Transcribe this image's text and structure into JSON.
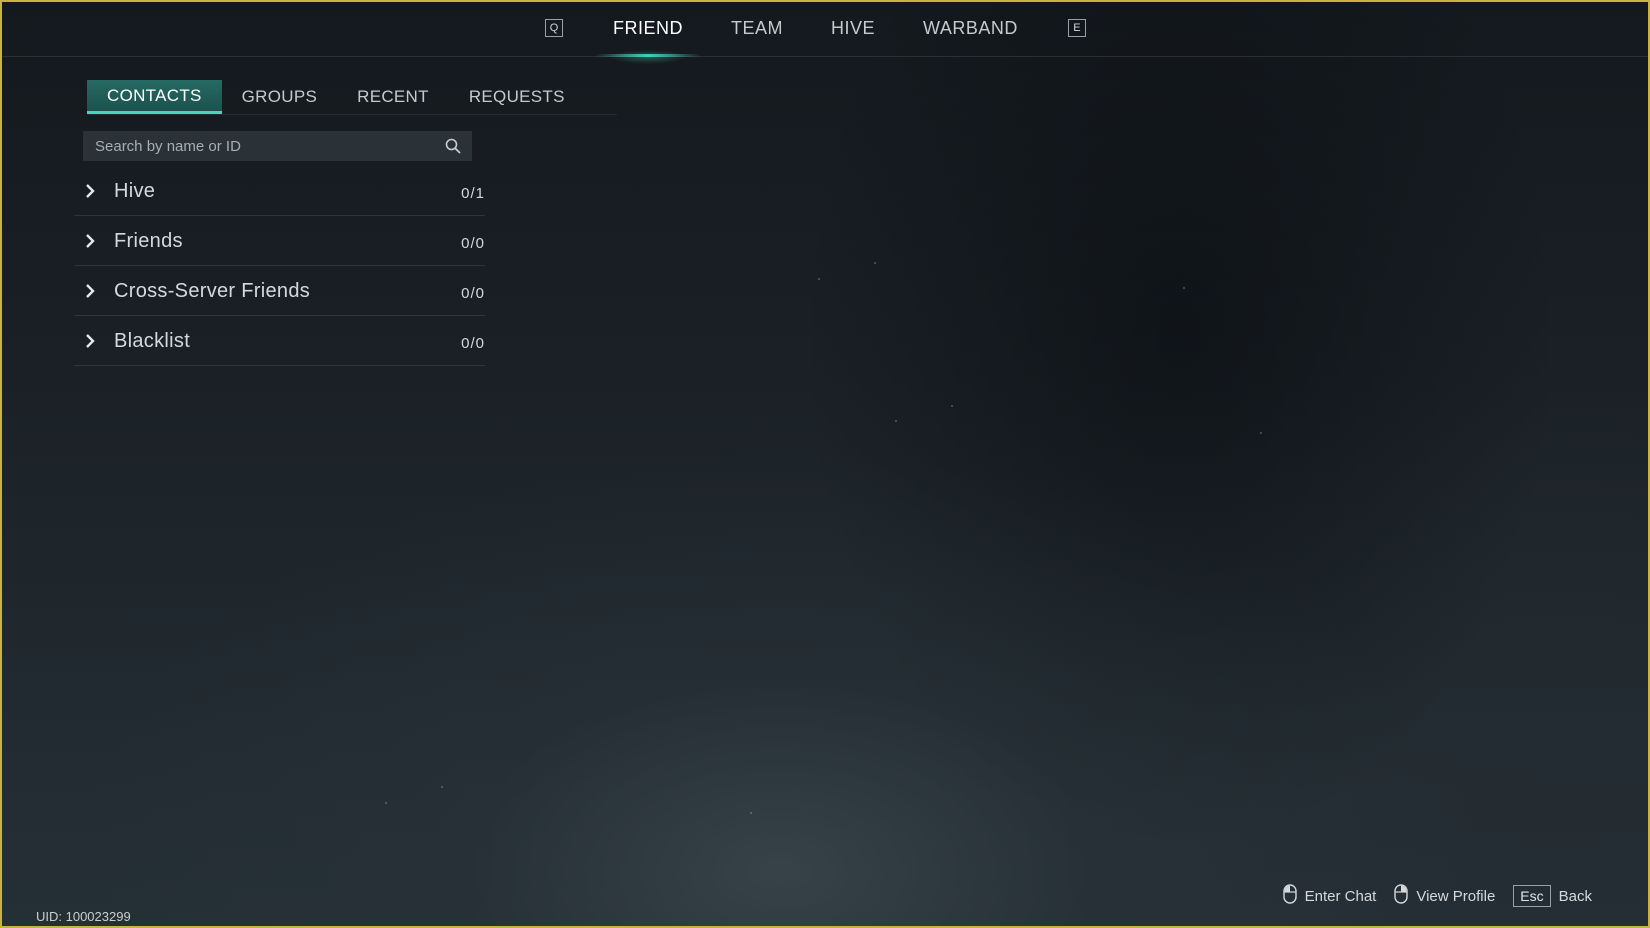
{
  "top_nav": {
    "prev_key": "Q",
    "next_key": "E",
    "tabs": [
      {
        "label": "FRIEND",
        "active": true
      },
      {
        "label": "TEAM",
        "active": false
      },
      {
        "label": "HIVE",
        "active": false
      },
      {
        "label": "WARBAND",
        "active": false
      }
    ]
  },
  "sub_tabs": [
    {
      "label": "CONTACTS",
      "active": true
    },
    {
      "label": "GROUPS",
      "active": false
    },
    {
      "label": "RECENT",
      "active": false
    },
    {
      "label": "REQUESTS",
      "active": false
    }
  ],
  "search": {
    "placeholder": "Search by name or ID",
    "value": "",
    "icon": "search-icon"
  },
  "groups": [
    {
      "name": "Hive",
      "count": "0/1"
    },
    {
      "name": "Friends",
      "count": "0/0"
    },
    {
      "name": "Cross-Server Friends",
      "count": "0/0"
    },
    {
      "name": "Blacklist",
      "count": "0/0"
    }
  ],
  "footer": {
    "uid": "UID: 100023299",
    "hints": {
      "enter_chat": "Enter Chat",
      "view_profile": "View Profile",
      "back_key": "Esc",
      "back": "Back"
    }
  },
  "colors": {
    "accent": "#41d1b8",
    "frame": "#c9b23d",
    "background": "#1a2026"
  }
}
